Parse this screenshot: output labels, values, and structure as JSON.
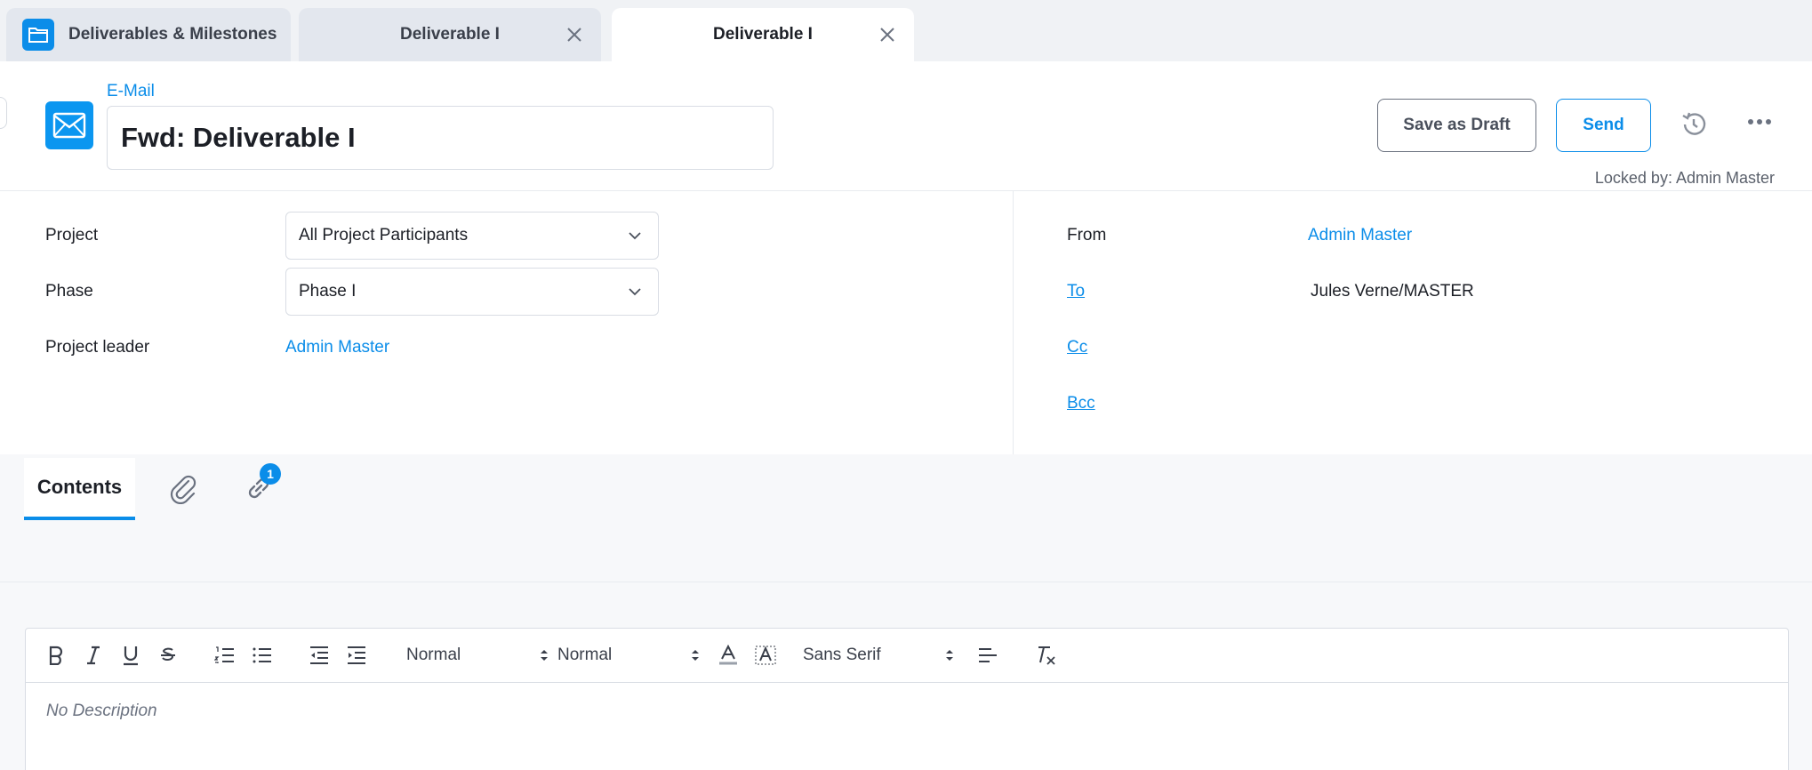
{
  "tabs": [
    {
      "label": "Deliverables & Milestones",
      "icon": "folder-icon"
    },
    {
      "label": "Deliverable I",
      "closable": true
    },
    {
      "label": "Deliverable I",
      "closable": true,
      "active": true
    }
  ],
  "header": {
    "kind": "E-Mail",
    "subject": "Fwd: Deliverable I",
    "save_draft_label": "Save as Draft",
    "send_label": "Send",
    "locked_text": "Locked by: Admin Master"
  },
  "left_fields": {
    "project_label": "Project",
    "project_value": "All Project Participants",
    "phase_label": "Phase",
    "phase_value": "Phase I",
    "leader_label": "Project leader",
    "leader_value": "Admin Master"
  },
  "right_fields": {
    "from_label": "From",
    "from_value": "Admin Master",
    "to_label": "To",
    "to_value": "Jules Verne/MASTER",
    "cc_label": "Cc",
    "bcc_label": "Bcc"
  },
  "content_tabs": {
    "contents_label": "Contents",
    "links_badge": "1"
  },
  "editor": {
    "header_select": "Normal",
    "size_select": "Normal",
    "font_select": "Sans Serif",
    "placeholder": "No Description"
  },
  "colors": {
    "accent": "#0b8de9",
    "border": "#d9dde4"
  }
}
